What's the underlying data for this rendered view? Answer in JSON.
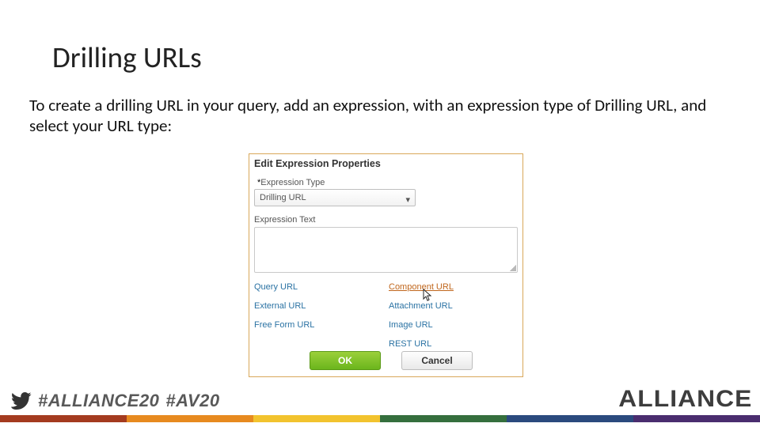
{
  "title": "Drilling URLs",
  "body": "To create a drilling URL in your query, add an expression, with an expression type of Drilling URL, and select your URL type:",
  "dialog": {
    "heading": "Edit Expression Properties",
    "type_label": "Expression Type",
    "type_value": "Drilling URL",
    "text_label": "Expression Text",
    "text_value": "",
    "links_left": [
      "Query URL",
      "External URL",
      "Free Form URL"
    ],
    "links_right": [
      "Component URL",
      "Attachment URL",
      "Image URL",
      "REST URL"
    ],
    "ok": "OK",
    "cancel": "Cancel"
  },
  "footer": {
    "hashtag1": "#ALLIANCE20",
    "hashtag2": "#AV20",
    "brand": "ALLIANCE"
  }
}
